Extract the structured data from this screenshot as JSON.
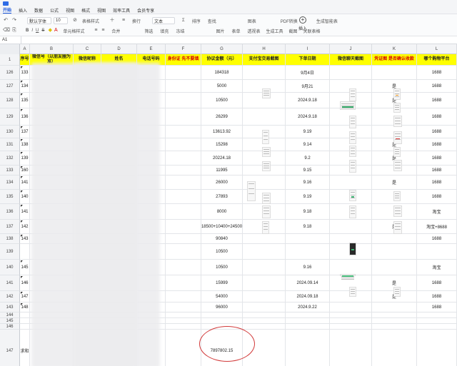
{
  "titlebar": {
    "doc_title": ""
  },
  "menu": {
    "items": [
      "开始",
      "插入",
      "数据",
      "公式",
      "视图",
      "格式",
      "视图",
      "效率工具",
      "会员专享"
    ]
  },
  "toolbar": {
    "font_name": "默认字体",
    "font_size": "10",
    "number_format": "文本",
    "table_style": "表格样式",
    "cell_style": "单元格样式",
    "wrap": "换行",
    "filter": "筛选",
    "sort": "排序",
    "fill": "填充",
    "find": "查找",
    "insert": "插入",
    "image": "图片",
    "chart": "图表",
    "form": "表单",
    "pivot": "透视表",
    "pdf": "PDF转换",
    "gen_table": "生成智能表",
    "merge": "合并",
    "freeze": "冻结",
    "gen_tool": "生成工具",
    "screenshot": "截图",
    "relation": "关联表格"
  },
  "formula_bar": {
    "cell_ref": "A1",
    "value": ""
  },
  "columns": [
    "A",
    "B",
    "C",
    "D",
    "E",
    "F",
    "G",
    "H",
    "I",
    "J",
    "K",
    "L"
  ],
  "header_row": {
    "row_no": "1",
    "cells": [
      "序号",
      "微信号（以朋友圈为准）",
      "微信昵称",
      "姓名",
      "电话号码",
      "身份证 先不要填",
      "协议金额（元）",
      "支付宝交易截图",
      "下单日期",
      "微信聊天截图",
      "凭证图 是否确认收款",
      "哪个购物平台"
    ]
  },
  "rows": [
    {
      "rn": "126",
      "a": "133",
      "g": "184318",
      "h": "",
      "i": "9月4日",
      "k": "",
      "l": "1688"
    },
    {
      "rn": "127",
      "a": "134",
      "g": "5000",
      "h": "",
      "i": "9月21",
      "k": "是",
      "l": "1688"
    },
    {
      "rn": "128",
      "a": "135",
      "g": "10500",
      "h": "",
      "i": "2024.9.18",
      "k": "是",
      "l": "1688"
    },
    {
      "rn": "129",
      "a": "136",
      "g": "26299",
      "h": "",
      "i": "2024.9.18",
      "k": "",
      "l": "1688"
    },
    {
      "rn": "130",
      "a": "137",
      "g": "13613.92",
      "h": "",
      "i": "9.19",
      "k": "",
      "l": "1688"
    },
    {
      "rn": "131",
      "a": "138",
      "g": "15298",
      "h": "",
      "i": "9.14",
      "k": "是",
      "l": "1688"
    },
    {
      "rn": "132",
      "a": "139",
      "g": "20224.18",
      "h": "",
      "i": "9.2",
      "k": "是",
      "l": "1688"
    },
    {
      "rn": "133",
      "a": "160",
      "g": "11995",
      "h": "",
      "i": "9.15",
      "k": "",
      "l": "1688"
    },
    {
      "rn": "134",
      "a": "141",
      "g": "26000",
      "h": "",
      "i": "9.16",
      "k": "是",
      "l": "1688"
    },
    {
      "rn": "135",
      "a": "140",
      "g": "27893",
      "h": "",
      "i": "9.19",
      "k": "",
      "l": "1688"
    },
    {
      "rn": "136",
      "a": "141",
      "g": "8000",
      "h": "",
      "i": "9.18",
      "k": "",
      "l": "淘宝"
    },
    {
      "rn": "137",
      "a": "142",
      "g": "18500+10400+24500",
      "h": "",
      "i": "9.18",
      "k": "是",
      "l": "淘宝+8688"
    },
    {
      "rn": "138",
      "a": "143",
      "g": "90840",
      "h": "",
      "i": "",
      "k": "",
      "l": "1688"
    },
    {
      "rn": "139",
      "a": "",
      "g": "10500",
      "h": "",
      "i": "",
      "k": "",
      "l": ""
    },
    {
      "rn": "140",
      "a": "145",
      "g": "10500",
      "h": "",
      "i": "9.16",
      "k": "",
      "l": "淘宝"
    },
    {
      "rn": "141",
      "a": "146",
      "g": "15999",
      "h": "",
      "i": "2024.09.14",
      "k": "是",
      "l": "1688"
    },
    {
      "rn": "142",
      "a": "147",
      "g": "54000",
      "h": "",
      "i": "2024.09.18",
      "k": "是",
      "l": "1688"
    },
    {
      "rn": "143",
      "a": "148",
      "g": "96000",
      "h": "",
      "i": "2024.9.22",
      "k": "",
      "l": "1688"
    },
    {
      "rn": "144",
      "a": "",
      "g": "",
      "h": "",
      "i": "",
      "k": "",
      "l": ""
    },
    {
      "rn": "145",
      "a": "",
      "g": "",
      "h": "",
      "i": "",
      "k": "",
      "l": ""
    },
    {
      "rn": "146",
      "a": "",
      "g": "",
      "h": "",
      "i": "",
      "k": "",
      "l": ""
    }
  ],
  "total_row": {
    "rn": "147",
    "label": "求和",
    "sum": "7897802.15"
  },
  "colors": {
    "header_fill": "#ffff00",
    "header_red": "#d40000",
    "oval": "#d23a3a",
    "accent": "#1a56db"
  }
}
